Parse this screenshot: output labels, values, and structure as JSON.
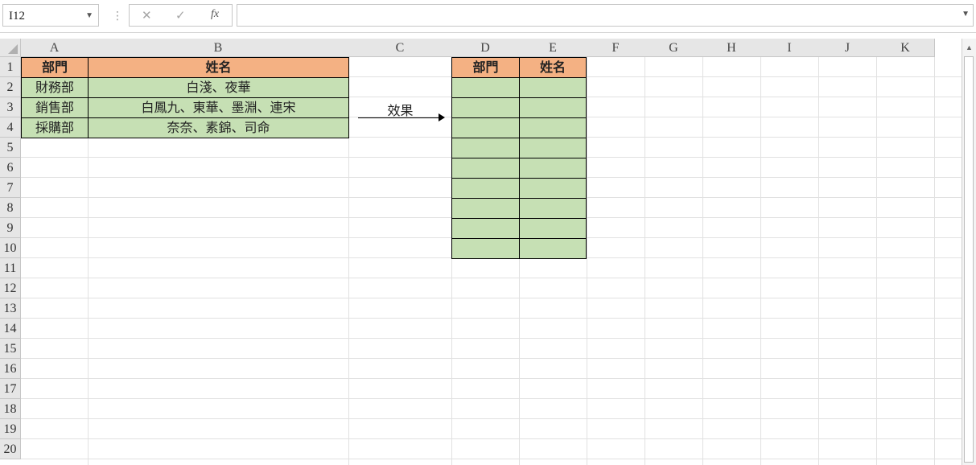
{
  "formula_bar": {
    "name_box": "I12",
    "cancel_glyph": "✕",
    "enter_glyph": "✓",
    "fx_label": "fx",
    "formula": ""
  },
  "columns": [
    "A",
    "B",
    "C",
    "D",
    "E",
    "F",
    "G",
    "H",
    "I",
    "J",
    "K"
  ],
  "rows": [
    "1",
    "2",
    "3",
    "4",
    "5",
    "6",
    "7",
    "8",
    "9",
    "10",
    "11",
    "12",
    "13",
    "14",
    "15",
    "16",
    "17",
    "18",
    "19",
    "20"
  ],
  "source_table": {
    "headers": [
      "部門",
      "姓名"
    ],
    "rows": [
      [
        "財務部",
        "白淺、夜華"
      ],
      [
        "銷售部",
        "白鳳九、東華、墨淵、連宋"
      ],
      [
        "採購部",
        "奈奈、素錦、司命"
      ]
    ]
  },
  "arrow_label": "效果",
  "result_table": {
    "headers": [
      "部門",
      "姓名"
    ]
  },
  "colors": {
    "header_fill": "#f4b183",
    "body_fill": "#c6e0b4"
  }
}
